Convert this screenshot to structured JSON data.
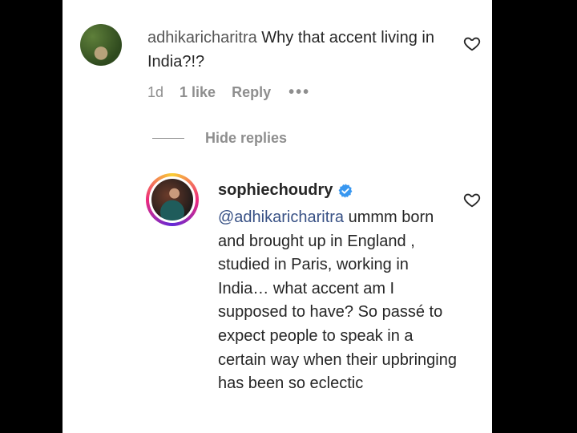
{
  "comment": {
    "username": "adhikaricharitra",
    "text": "Why that accent living in India?!?",
    "time": "1d",
    "likes": "1 like",
    "reply_label": "Reply",
    "more_label": "•••"
  },
  "replies_toggle": {
    "label": "Hide replies"
  },
  "reply": {
    "username": "sophiechoudry",
    "mention": "@adhikaricharitra",
    "text": " ummm born and brought up in England , studied in Paris, working in India… what accent am I supposed to have? So passé to expect people to speak in a certain way when their upbringing has been so eclectic"
  },
  "icons": {
    "like1": "heart-outline-icon",
    "like2": "heart-outline-icon",
    "verified": "verified-badge-icon"
  },
  "colors": {
    "mention": "#385185",
    "verified": "#3897f0",
    "secondary_text": "#8e8e8e"
  }
}
